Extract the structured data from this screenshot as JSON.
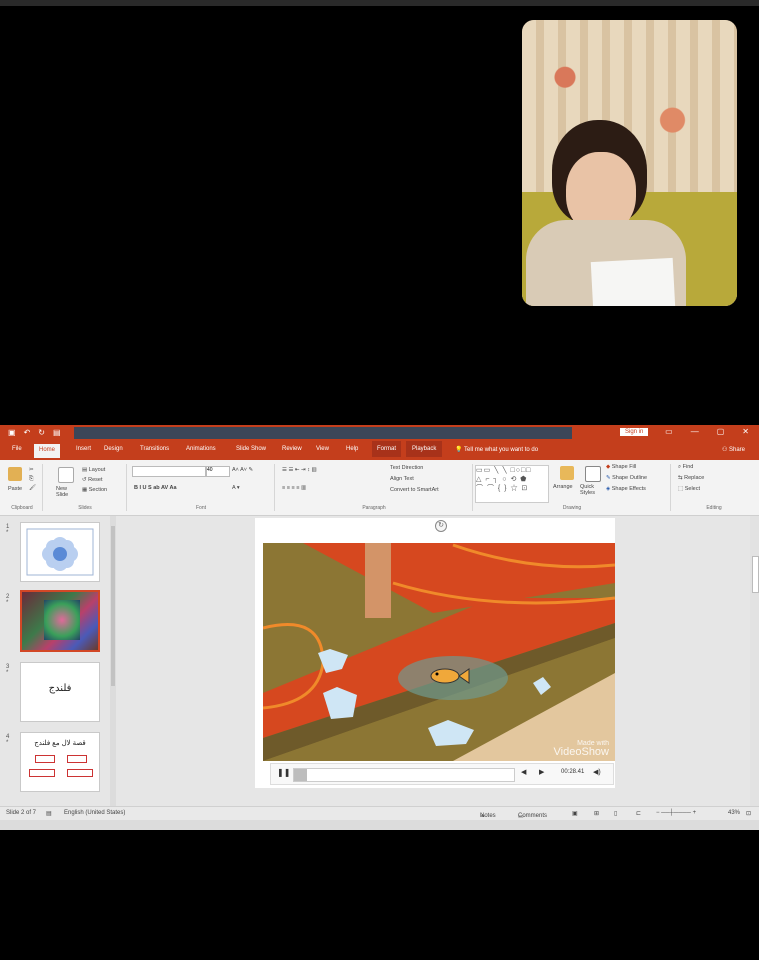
{
  "window": {
    "signin_label": "Sign in",
    "controls": [
      "▭",
      "—",
      "▢",
      "✕"
    ]
  },
  "ribbon_tabs": [
    "File",
    "Home",
    "Insert",
    "Design",
    "Transitions",
    "Animations",
    "Slide Show",
    "Review",
    "View",
    "Help",
    "Format",
    "Playback"
  ],
  "tell_me": "Tell me what you want to do",
  "share_label": "Share",
  "ribbon": {
    "paste": "Paste",
    "new_slide": "New Slide",
    "layout": "Layout",
    "reset": "Reset",
    "section": "Section",
    "font_name": "",
    "font_size": "40",
    "text_direction": "Text Direction",
    "align_text": "Align Text",
    "convert_smartart": "Convert to SmartArt",
    "arrange": "Arrange",
    "quick_styles": "Quick Styles",
    "shape_fill": "Shape Fill",
    "shape_outline": "Shape Outline",
    "shape_effects": "Shape Effects",
    "find": "Find",
    "replace": "Replace",
    "select": "Select",
    "groups": [
      "Clipboard",
      "Slides",
      "Font",
      "Paragraph",
      "Drawing",
      "Editing"
    ]
  },
  "slides": [
    {
      "num": "1",
      "star": "*"
    },
    {
      "num": "2",
      "star": "*"
    },
    {
      "num": "3",
      "star": "*",
      "text": "فلندج"
    },
    {
      "num": "4",
      "star": "*",
      "text": "قصة لال مع فلندج"
    }
  ],
  "video": {
    "watermark_line1": "Made with",
    "watermark_line2": "VideoShow",
    "time": "00:28.41",
    "progress": 0.06
  },
  "status": {
    "slide_info": "Slide 2 of 7",
    "language": "English (United States)",
    "notes": "Notes",
    "comments": "Comments",
    "zoom": "43%"
  },
  "colors": {
    "accent": "#c43e1c",
    "tab_dark": "#3b4658"
  }
}
